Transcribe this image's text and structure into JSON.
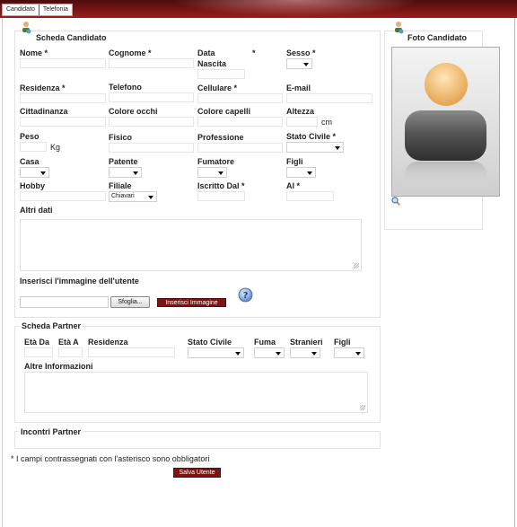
{
  "tabs": [
    "Candidato",
    "Telefonia"
  ],
  "candidate": {
    "title": "Scheda Candidato",
    "labels": {
      "nome": "Nome *",
      "cognome": "Cognome *",
      "data_nascita_1": "Data",
      "data_nascita_2": "Nascita",
      "asterisk": "*",
      "sesso": "Sesso *",
      "residenza": "Residenza *",
      "telefono": "Telefono",
      "cellulare": "Cellulare *",
      "email": "E-mail",
      "cittadinanza": "Cittadinanza",
      "colore_occhi": "Colore occhi",
      "colore_capelli": "Colore capelli",
      "altezza": "Altezza",
      "cm": "cm",
      "peso": "Peso",
      "kg": "Kg",
      "fisico": "Fisico",
      "professione": "Professione",
      "stato_civile": "Stato Civile *",
      "casa": "Casa",
      "patente": "Patente",
      "fumatore": "Fumatore",
      "figli": "Figli",
      "hobby": "Hobby",
      "filiale": "Filiale",
      "iscritto_dal": "Iscritto Dal *",
      "al": "Al *",
      "altri_dati": "Altri dati",
      "inserisci_immagine": "Inserisci l'immagine dell'utente"
    },
    "filiale_value": "Chiavari",
    "browse_button": "Sfoglia...",
    "insert_image_button": "Inserisci Immagine"
  },
  "photo": {
    "title": "Foto Candidato"
  },
  "partner": {
    "title": "Scheda Partner",
    "labels": {
      "eta_da": "Età Da",
      "eta_a": "Età A",
      "residenza": "Residenza",
      "stato_civile": "Stato Civile",
      "fuma": "Fuma",
      "stranieri": "Stranieri",
      "figli": "Figli",
      "altre_info": "Altre Informazioni"
    }
  },
  "incontri": {
    "title": "Incontri Partner"
  },
  "footer": {
    "note": "* I campi contrassegnati con l'asterisco sono obbligatori",
    "save_button": "Salva Utente"
  },
  "colors": {
    "accent": "#7b1414",
    "header": "#7d1515"
  }
}
